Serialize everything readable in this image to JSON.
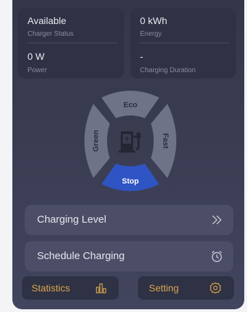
{
  "stats": {
    "status": {
      "value": "Available",
      "label": "Charger Status"
    },
    "energy": {
      "value": "0 kWh",
      "label": "Energy"
    },
    "power": {
      "value": "0 W",
      "label": "Power"
    },
    "duration": {
      "value": "-",
      "label": "Charging Duration"
    }
  },
  "modes": {
    "eco": "Eco",
    "green": "Green",
    "fast": "Fast",
    "stop": "Stop"
  },
  "center_icon": "ev-charger-icon",
  "actions": {
    "charging_level": {
      "label": "Charging Level",
      "icon": "double-chevron-right-icon"
    },
    "schedule_charging": {
      "label": "Schedule Charging",
      "icon": "alarm-clock-icon"
    }
  },
  "bottom": {
    "statistics": {
      "label": "Statistics",
      "icon": "bar-chart-icon"
    },
    "setting": {
      "label": "Setting",
      "icon": "gear-icon"
    }
  },
  "colors": {
    "background": "#3a3c52",
    "card": "#2f3144",
    "dial_segment": "#6e7388",
    "stop_segment": "#2f54c4",
    "accent": "#d9a64e"
  }
}
